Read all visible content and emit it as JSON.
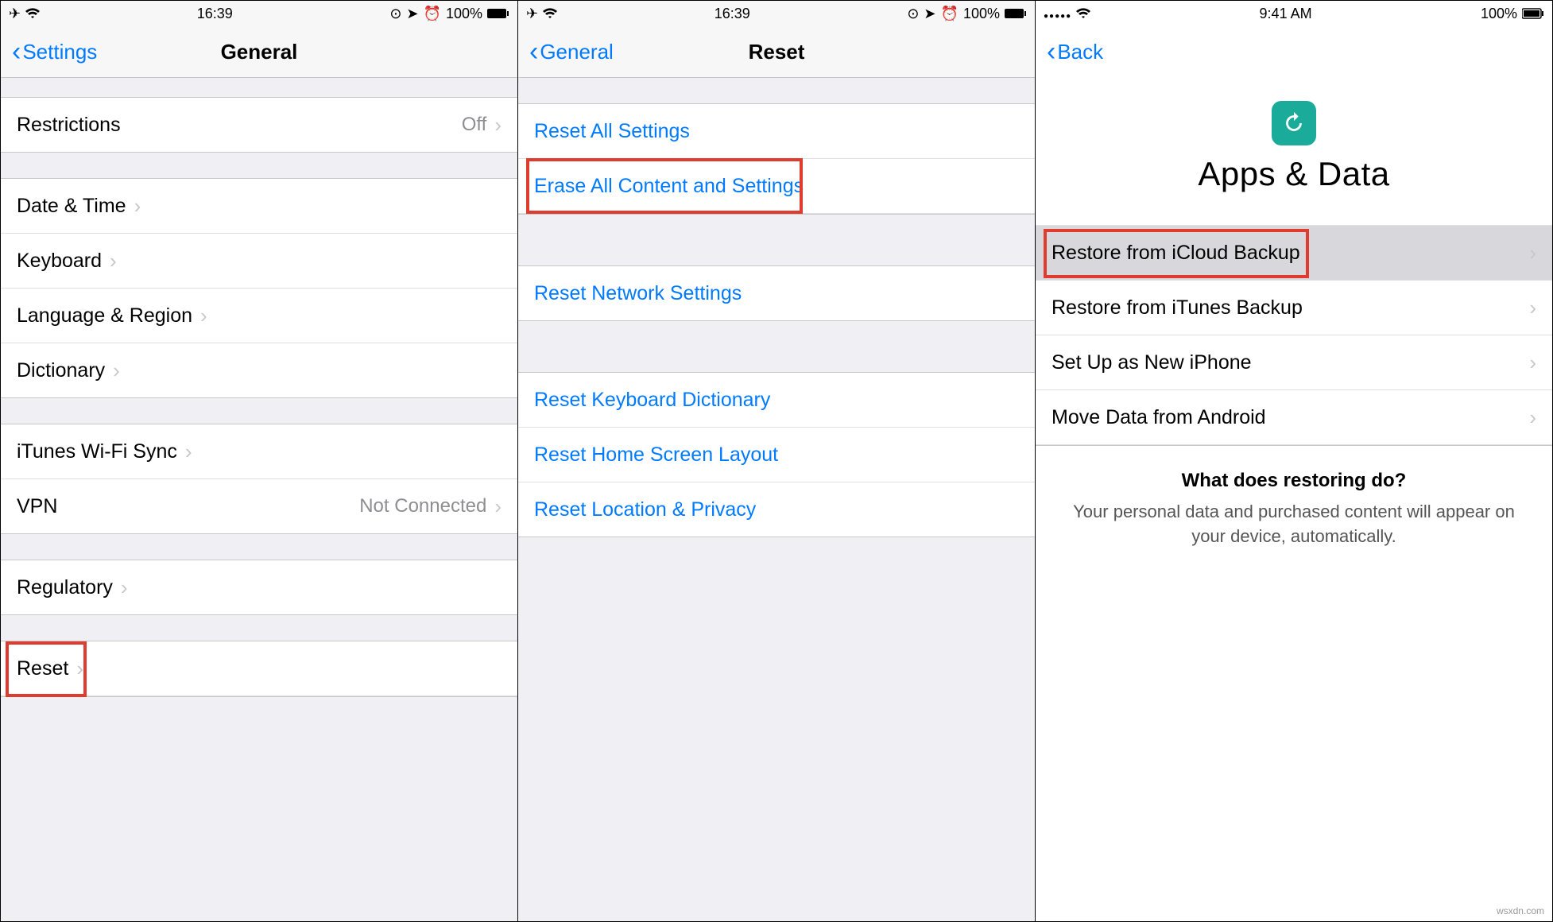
{
  "watermark": "wsxdn.com",
  "panes": {
    "general": {
      "status": {
        "time": "16:39",
        "battery": "100%"
      },
      "nav": {
        "back": "Settings",
        "title": "General"
      },
      "sections": [
        [
          {
            "label": "Restrictions",
            "value": "Off",
            "chevron": true
          }
        ],
        [
          {
            "label": "Date & Time",
            "chevron": true
          },
          {
            "label": "Keyboard",
            "chevron": true
          },
          {
            "label": "Language & Region",
            "chevron": true
          },
          {
            "label": "Dictionary",
            "chevron": true
          }
        ],
        [
          {
            "label": "iTunes Wi-Fi Sync",
            "chevron": true
          },
          {
            "label": "VPN",
            "value": "Not Connected",
            "chevron": true
          }
        ],
        [
          {
            "label": "Regulatory",
            "chevron": true
          }
        ],
        [
          {
            "label": "Reset",
            "chevron": true,
            "highlight": true
          }
        ]
      ]
    },
    "reset": {
      "status": {
        "time": "16:39",
        "battery": "100%"
      },
      "nav": {
        "back": "General",
        "title": "Reset"
      },
      "sections": [
        [
          {
            "label": "Reset All Settings",
            "blue": true
          },
          {
            "label": "Erase All Content and Settings",
            "blue": true,
            "highlight": true
          }
        ],
        [
          {
            "label": "Reset Network Settings",
            "blue": true
          }
        ],
        [
          {
            "label": "Reset Keyboard Dictionary",
            "blue": true
          },
          {
            "label": "Reset Home Screen Layout",
            "blue": true
          },
          {
            "label": "Reset Location & Privacy",
            "blue": true
          }
        ]
      ]
    },
    "apps": {
      "status": {
        "time": "9:41 AM",
        "battery": "100%"
      },
      "nav": {
        "back": "Back"
      },
      "hero": {
        "title": "Apps & Data"
      },
      "options": [
        {
          "label": "Restore from iCloud Backup",
          "selected": true,
          "highlight": true,
          "chevron": true
        },
        {
          "label": "Restore from iTunes Backup",
          "chevron": true
        },
        {
          "label": "Set Up as New iPhone",
          "chevron": true
        },
        {
          "label": "Move Data from Android",
          "chevron": true
        }
      ],
      "footer": {
        "question": "What does restoring do?",
        "detail": "Your personal data and purchased content will appear on your device, automatically."
      }
    }
  }
}
